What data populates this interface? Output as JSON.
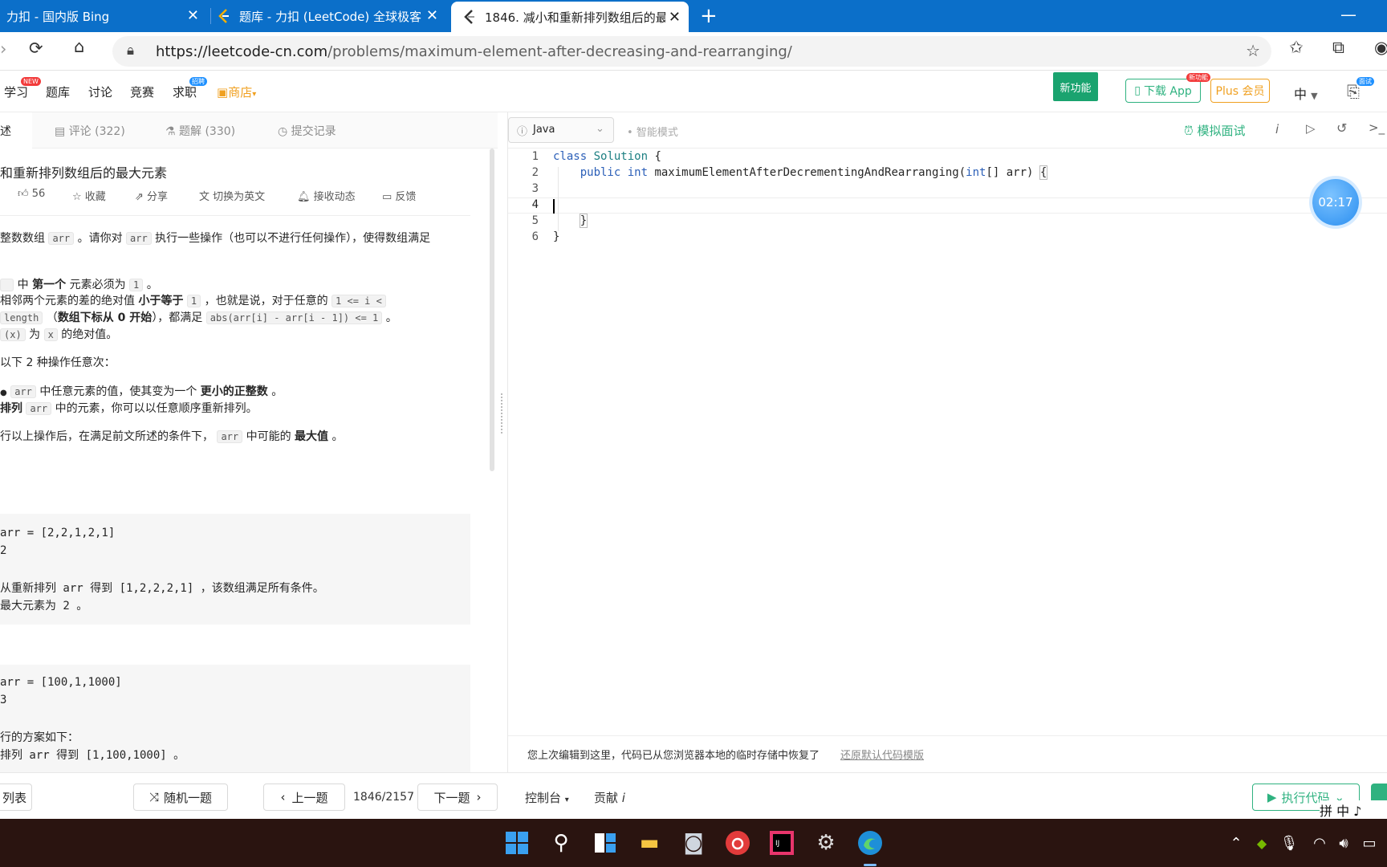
{
  "browser": {
    "tabs": [
      {
        "title": "力扣 - 国内版 Bing"
      },
      {
        "title": "题库 - 力扣 (LeetCode) 全球极客"
      },
      {
        "title": "1846. 减小和重新排列数组后的最"
      }
    ],
    "url_host": "https://leetcode-cn.com",
    "url_path": "/problems/maximum-element-after-decreasing-and-rearranging/"
  },
  "sitenav": {
    "items": [
      "学习",
      "题库",
      "讨论",
      "竞赛",
      "求职",
      "商店"
    ],
    "badge_new": "NEW",
    "badge_job": "招聘",
    "new_feature": "新功能",
    "download_app": "下载 App",
    "download_badge": "新功能",
    "plus": "Plus 会员",
    "lang": "中",
    "interview_badge": "面试"
  },
  "left": {
    "tabs": [
      "述",
      "评论 (322)",
      "题解 (330)",
      "提交记录"
    ],
    "title": "和重新排列数组后的最大元素",
    "likes": "56",
    "actions": [
      "收藏",
      "分享",
      "切换为英文",
      "接收动态",
      "反馈"
    ],
    "desc": {
      "l1a": "整数数组 ",
      "l1code": "arr",
      "l1b": " 。请你对 ",
      "l1code2": "arr",
      "l1c": " 执行一些操作（也可以不进行任何操作），使得数组满足",
      "r1a": " 中 ",
      "r1b": "第一个",
      "r1c": " 元素必须为 ",
      "r1code": "1",
      "r1d": " 。",
      "r2a": "相邻两个元素的差的绝对值 ",
      "r2b": "小于等于",
      "r2code": "1",
      "r2c": " ，也就是说，对于任意的 ",
      "r2code2": "1 <= i <",
      "r3code": "length",
      "r3a": " （",
      "r3b": "数组下标从 0 开始",
      "r3c": "），都满足 ",
      "r3code2": "abs(arr[i] - arr[i - 1]) <= 1",
      "r3d": " 。",
      "r4code": "(x)",
      "r4a": " 为 ",
      "r4code2": "x",
      "r4b": " 的绝对值。",
      "ops": "以下 2 种操作任意次：",
      "o1code": "arr",
      "o1a": " 中任意元素的值，使其变为一个 ",
      "o1b": "更小的正整数",
      "o1c": " 。",
      "o2a": "排列",
      "o2code": "arr",
      "o2b": " 中的元素，你可以以任意顺序重新排列。",
      "fa": "行以上操作后，在满足前文所述的条件下， ",
      "fcode": "arr",
      "fb": " 中可能的 ",
      "fc": "最大值",
      "fd": " 。"
    },
    "ex1": [
      "arr = [2,2,1,2,1]",
      "2",
      "",
      "从重新排列 arr 得到 [1,2,2,2,1] ，该数组满足所有条件。",
      "最大元素为 2 。"
    ],
    "ex2": [
      "arr = [100,1,1000]",
      "3",
      "",
      "行的方案如下：",
      "排列 arr 得到 [1,100,1000] 。"
    ]
  },
  "editor": {
    "lang": "Java",
    "smart_mode": "智能模式",
    "mock_interview": "模拟面试",
    "timer": "02:17",
    "code": [
      "class Solution {",
      "    public int maximumElementAfterDecrementingAndRearranging(int[] arr) {",
      "",
      "",
      "    }",
      "}"
    ],
    "restore_msg": "您上次编辑到这里，代码已从您浏览器本地的临时存储中恢复了",
    "restore_link": "还原默认代码模版"
  },
  "bottom": {
    "list": "列表",
    "random": "随机一题",
    "prev": "上一题",
    "counter": "1846/2157",
    "next": "下一题",
    "console": "控制台",
    "contribute": "贡献",
    "run": "执行代码",
    "ime": "拼 中 ♪"
  }
}
